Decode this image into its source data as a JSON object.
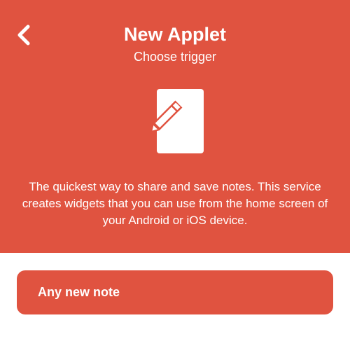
{
  "header": {
    "title": "New Applet",
    "subtitle": "Choose trigger",
    "back_icon": "chevron-left-icon",
    "background_color": "#e05340"
  },
  "service": {
    "icon": "notes-pencil-icon",
    "description": "The quickest way to share and save notes. This service creates widgets that you can use from the home screen of your Android or iOS device."
  },
  "triggers": [
    {
      "label": "Any new note"
    }
  ]
}
